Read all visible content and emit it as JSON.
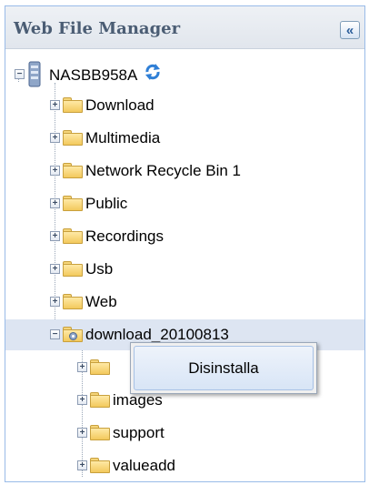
{
  "header": {
    "title": "Web File Manager",
    "collapse_glyph": "«"
  },
  "tree": {
    "root": {
      "label": "NASBB958A",
      "icon": "server-icon",
      "refresh_icon": "refresh-icon"
    },
    "folders": [
      {
        "label": "Download"
      },
      {
        "label": "Multimedia"
      },
      {
        "label": "Network Recycle Bin 1"
      },
      {
        "label": "Public"
      },
      {
        "label": "Recordings"
      },
      {
        "label": "Usb"
      },
      {
        "label": "Web"
      }
    ],
    "selected": {
      "label": "download_20100813"
    },
    "children": [
      {
        "label": ""
      },
      {
        "label": "images"
      },
      {
        "label": "support"
      },
      {
        "label": "valueadd"
      }
    ]
  },
  "context_menu": {
    "item": "Disinstalla"
  },
  "colors": {
    "accent": "#99bbe8",
    "selection": "#dde5f2",
    "folder": "#f3c95c"
  }
}
